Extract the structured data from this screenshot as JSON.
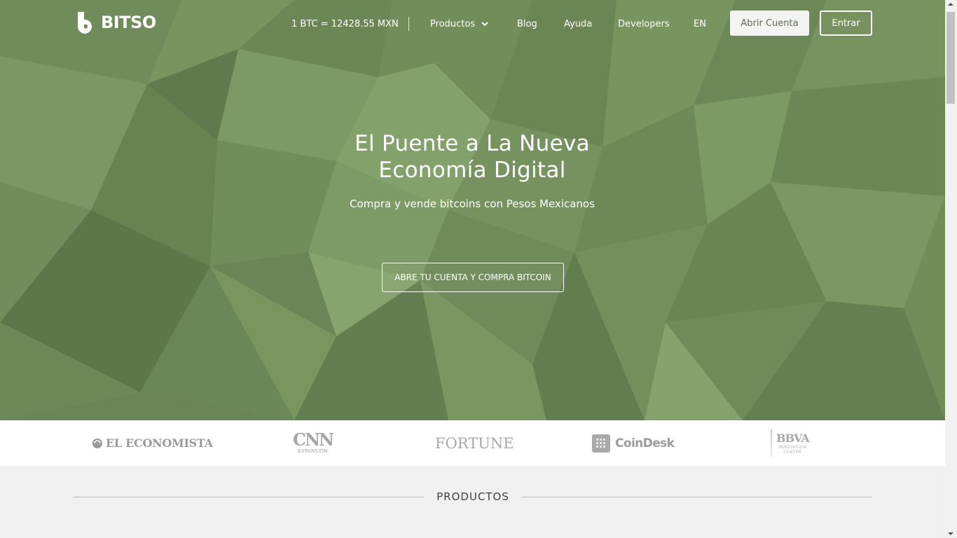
{
  "brand": {
    "name": "BITSO",
    "icon": "bitso-logo-icon"
  },
  "nav": {
    "rate": "1 BTC = 12428.55 MXN",
    "items": [
      {
        "label": "Productos",
        "icon": "chevron-down-icon"
      },
      {
        "label": "Blog"
      },
      {
        "label": "Ayuda"
      },
      {
        "label": "Developers"
      },
      {
        "label": "EN"
      }
    ],
    "open_account": "Abrir Cuenta",
    "login": "Entrar"
  },
  "hero": {
    "title_line1": "El Puente a La Nueva",
    "title_line2": "Economía Digital",
    "subtitle": "Compra y vende bitcoins con Pesos Mexicanos",
    "cta": "ABRE TU CUENTA Y COMPRA BITCOIN",
    "background_color": "#6a8656"
  },
  "press": {
    "el_economista": "EL ECONOMISTA",
    "cnn": "CNN",
    "cnn_sub": "EXPANSION",
    "fortune": "FORTUNE",
    "coindesk": "CoinDesk",
    "bbva": "BBVA",
    "bbva_sub1": "INNOVATION",
    "bbva_sub2": "CENTER"
  },
  "products": {
    "title": "PRODUCTOS"
  }
}
